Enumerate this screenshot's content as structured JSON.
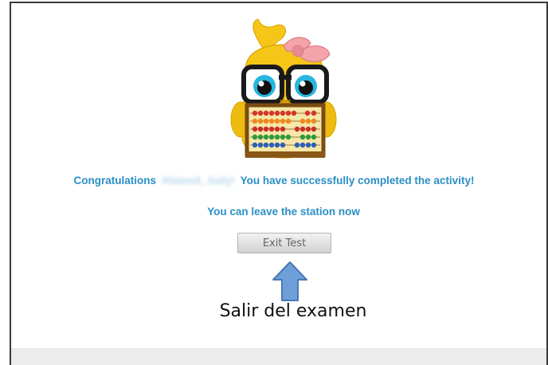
{
  "message": {
    "congrats_prefix": "Congratulations",
    "student_name": "Alateed, Judy!",
    "congrats_suffix": "You have successfully completed the activity!",
    "leave": "You can leave the station now"
  },
  "buttons": {
    "exit_label": "Exit Test"
  },
  "annotation": {
    "caption": "Salir del examen"
  },
  "colors": {
    "message_text": "#2a8fc6",
    "mascot_body": "#f5c518",
    "bow": "#f4a3a8",
    "arrow": "#6f9fd8"
  },
  "icons": {
    "mascot": "owl-mascot-with-abacus-icon",
    "annotation": "up-arrow-icon"
  }
}
